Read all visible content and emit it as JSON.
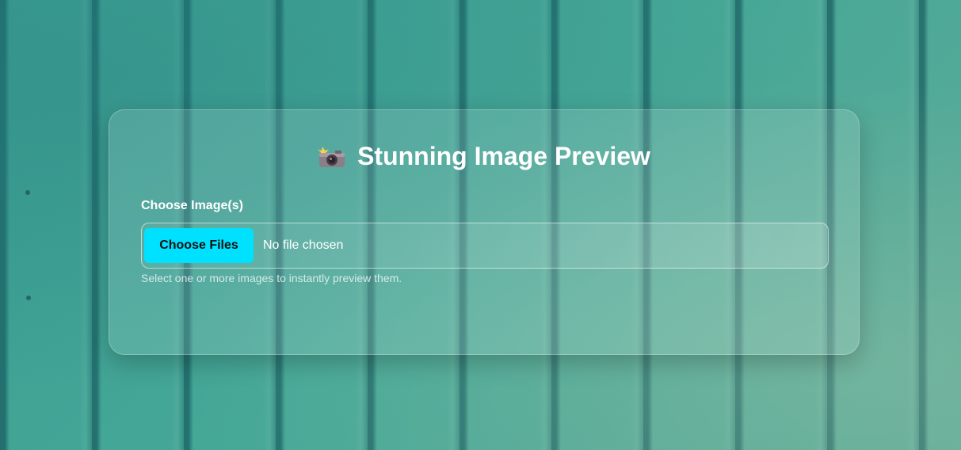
{
  "page": {
    "title": "Stunning Image Preview",
    "title_icon": "camera-flash-icon"
  },
  "form": {
    "label": "Choose Image(s)",
    "button_label": "Choose Files",
    "file_status": "No file chosen",
    "hint": "Select one or more images to instantly preview them."
  },
  "colors": {
    "accent": "#00e0ff",
    "background": "#3fa596",
    "text": "#ffffff"
  }
}
